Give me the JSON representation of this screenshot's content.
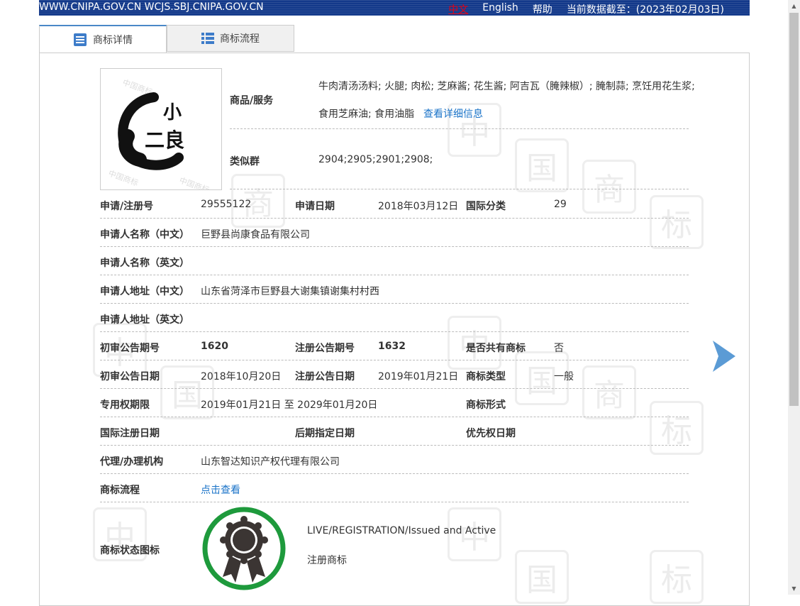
{
  "topbar": {
    "site": "WWW.CNIPA.GOV.CN WCJS.SBJ.CNIPA.GOV.CN",
    "lang_zh": "中文",
    "lang_en": "English",
    "help": "帮助",
    "data_date": "当前数据截至：(2023年02月03日)"
  },
  "tabs": [
    {
      "label": "商标详情",
      "icon": "document-list-icon"
    },
    {
      "label": "商标流程",
      "icon": "list-icon"
    }
  ],
  "logo": {
    "chars_top": "小",
    "chars_bottom": "二良"
  },
  "detail": {
    "goods_label": "商品/服务",
    "goods_line1": "牛肉清汤汤料; 火腿; 肉松; 芝麻酱; 花生酱; 阿吉瓦（腌辣椒）; 腌制蒜; 烹饪用花生浆;",
    "goods_line2": "食用芝麻油; 食用油脂",
    "goods_more": "查看详细信息",
    "similar_label": "类似群",
    "similar_value": "2904;2905;2901;2908;",
    "reg_no_label": "申请/注册号",
    "reg_no": "29555122",
    "app_date_label": "申请日期",
    "app_date": "2018年03月12日",
    "intl_class_label": "国际分类",
    "intl_class": "29",
    "applicant_cn_label": "申请人名称（中文）",
    "applicant_cn": "巨野县尚康食品有限公司",
    "applicant_en_label": "申请人名称（英文）",
    "address_cn_label": "申请人地址（中文）",
    "address_cn": "山东省菏泽市巨野县大谢集镇谢集村村西",
    "address_en_label": "申请人地址（英文）",
    "prelim_no_label": "初审公告期号",
    "prelim_no": "1620",
    "reg_pub_no_label": "注册公告期号",
    "reg_pub_no": "1632",
    "shared_label": "是否共有商标",
    "shared": "否",
    "prelim_date_label": "初审公告日期",
    "prelim_date": "2018年10月20日",
    "reg_pub_date_label": "注册公告日期",
    "reg_pub_date": "2019年01月21日",
    "type_label": "商标类型",
    "type": "一般",
    "term_label": "专用权期限",
    "term": "2019年01月21日 至 2029年01月20日",
    "form_label": "商标形式",
    "intl_reg_date_label": "国际注册日期",
    "later_date_label": "后期指定日期",
    "priority_date_label": "优先权日期",
    "agent_label": "代理/办理机构",
    "agent": "山东智达知识产权代理有限公司",
    "flow_label": "商标流程",
    "flow_link": "点击查看",
    "status_icon_label": "商标状态图标",
    "status_en": "LIVE/REGISTRATION/Issued and Active",
    "status_cn": "注册商标"
  },
  "colors": {
    "topbar": "#13398a",
    "link": "#1a73c8",
    "status_ring": "#1e9a3c",
    "arrow": "#5b9bd5"
  }
}
